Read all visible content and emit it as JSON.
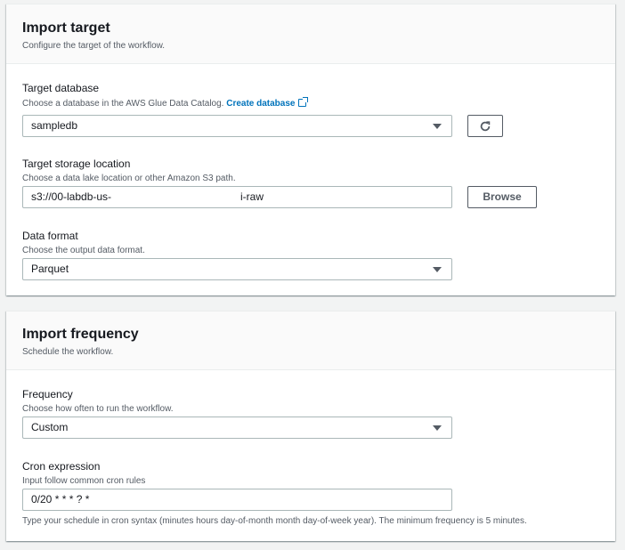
{
  "import_target": {
    "title": "Import target",
    "subtitle": "Configure the target of the workflow.",
    "target_database": {
      "label": "Target database",
      "description": "Choose a database in the AWS Glue Data Catalog.",
      "link": "Create database",
      "value": "sampledb"
    },
    "storage_location": {
      "label": "Target storage location",
      "description": "Choose a data lake location or other Amazon S3 path.",
      "value_start": "s3://00-labdb-us-",
      "value_end": "i-raw",
      "browse_label": "Browse"
    },
    "data_format": {
      "label": "Data format",
      "description": "Choose the output data format.",
      "value": "Parquet"
    }
  },
  "import_frequency": {
    "title": "Import frequency",
    "subtitle": "Schedule the workflow.",
    "frequency": {
      "label": "Frequency",
      "description": "Choose how often to run the workflow.",
      "value": "Custom"
    },
    "cron": {
      "label": "Cron expression",
      "description": "Input follow common cron rules",
      "value": "0/20 * * * ? *",
      "hint": "Type your schedule in cron syntax (minutes hours day-of-month month day-of-week year). The minimum frequency is 5 minutes."
    }
  },
  "icons": {
    "refresh": "refresh-icon",
    "external": "external-link-icon",
    "dropdown": "caret-down-icon"
  }
}
